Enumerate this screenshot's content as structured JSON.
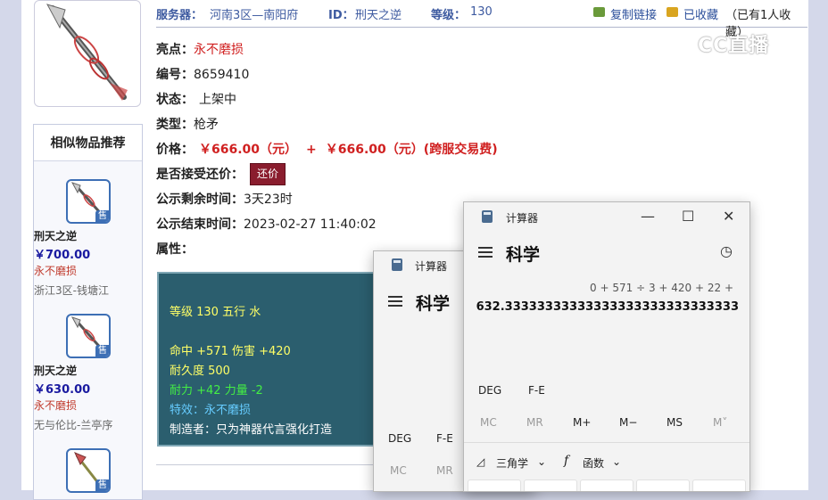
{
  "header": {
    "server_label": "服务器：",
    "server_value": "河南3区—南阳府",
    "id_label": "ID：",
    "id_value": "刑天之逆",
    "level_label": "等级：",
    "level_value": "130",
    "copy_link": "复制链接",
    "favorited": "已收藏",
    "fav_count": "（已有1人收藏）"
  },
  "watermark": "CC直播",
  "details": {
    "highlight_label": "亮点：",
    "highlight_value": "永不磨损",
    "code_label": "编号：",
    "code_value": "8659410",
    "status_label": "状态：",
    "status_value": "上架中",
    "type_label": "类型：",
    "type_value": "枪矛",
    "price_label": "价格：",
    "price_value": "￥666.00（元）",
    "price_plus": "+",
    "price_cross": "￥666.00（元）(跨服交易费)",
    "counter_label": "是否接受还价：",
    "counter_button": "还价",
    "remaining_label": "公示剩余时间：",
    "remaining_value": "3天23时",
    "end_label": "公示结束时间：",
    "end_value": "2023-02-27 11:40:02",
    "attr_label": "属性："
  },
  "stats": {
    "line1": "等级 130 五行 水",
    "line2": "命中 +571 伤害 +420",
    "line3": "耐久度 500",
    "line4": "耐力 +42 力量 -2",
    "line5": "特效：永不磨损",
    "line6": "制造者：只为神器代言强化打造"
  },
  "recommend": {
    "title": "相似物品推荐",
    "badge": "售",
    "items": [
      {
        "name": "刑天之逆",
        "price": "￥700.00",
        "tag": "永不磨损",
        "server": "浙江3区-钱塘江"
      },
      {
        "name": "刑天之逆",
        "price": "￥630.00",
        "tag": "永不磨损",
        "server": "无与伦比-兰亭序"
      },
      {
        "name": "",
        "price": "",
        "tag": "",
        "server": ""
      }
    ]
  },
  "calc_back": {
    "title": "计算器",
    "mode": "科学",
    "deg": "DEG",
    "fe": "F-E",
    "mc": "MC",
    "mr": "MR"
  },
  "calc_front": {
    "title": "计算器",
    "mode": "科学",
    "expression": "0 + 571 ÷ 3 + 420 + 22 +",
    "result": "632.33333333333333333333333333333",
    "deg": "DEG",
    "fe": "F-E",
    "mc": "MC",
    "mr": "MR",
    "mplus": "M+",
    "mminus": "M−",
    "ms": "MS",
    "mlist": "M˅",
    "trig": "三角学",
    "func": "函数"
  },
  "colors": {
    "accent_blue": "#3d5aa0",
    "price_red": "#d02020",
    "counter_btn": "#8a1d2e",
    "stats_bg": "#2b5e6e",
    "stat_yellow": "#ffff66",
    "stat_green": "#44ee44",
    "stat_cyan": "#66ccff"
  }
}
